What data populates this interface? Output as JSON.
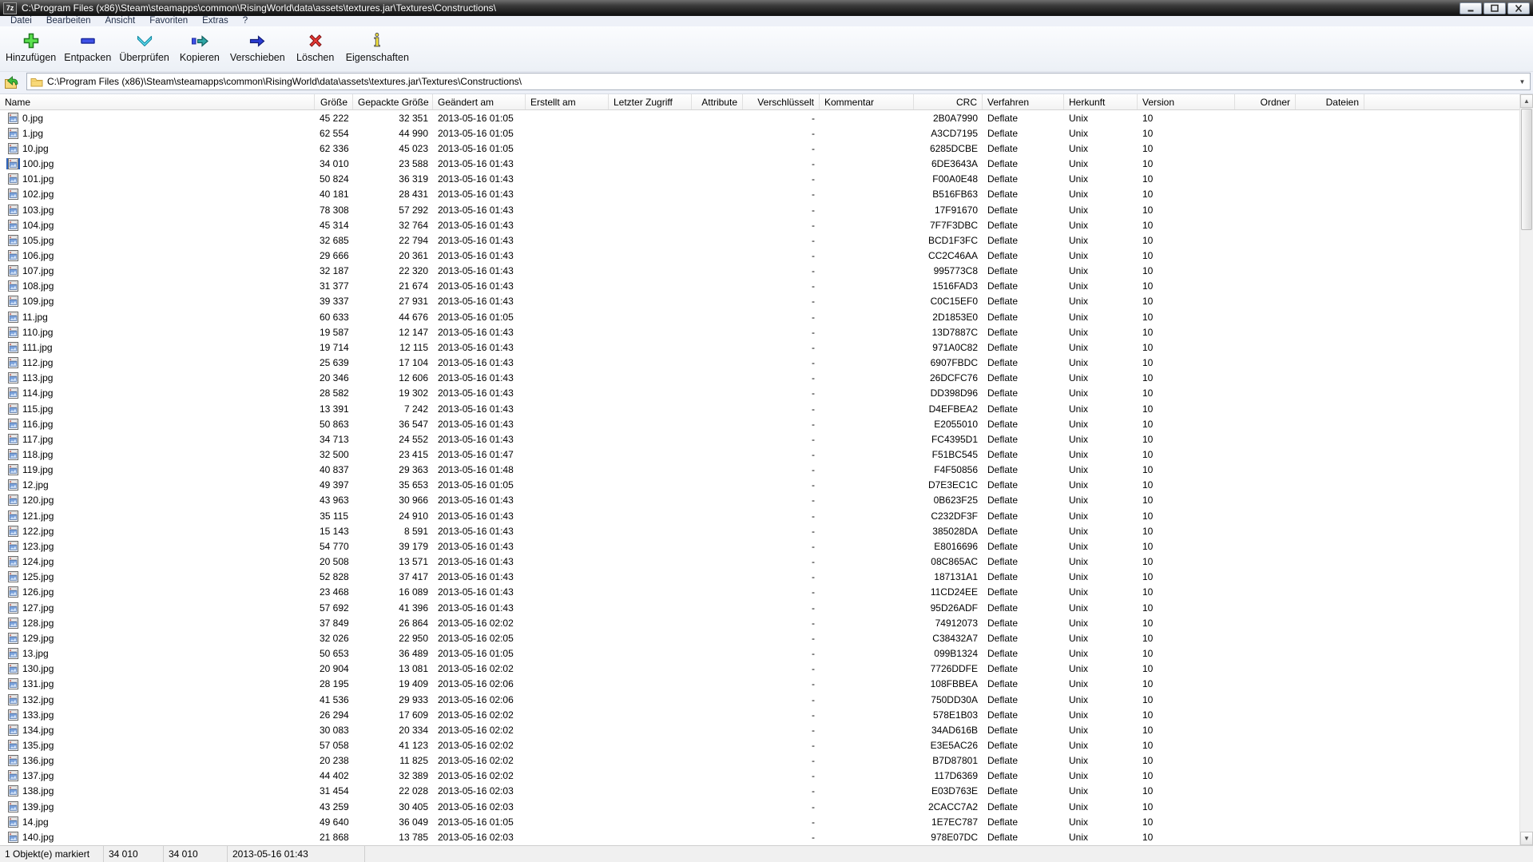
{
  "window": {
    "title": "C:\\Program Files (x86)\\Steam\\steamapps\\common\\RisingWorld\\data\\assets\\textures.jar\\Textures\\Constructions\\",
    "app_badge": "7z"
  },
  "menu": {
    "items": [
      "Datei",
      "Bearbeiten",
      "Ansicht",
      "Favoriten",
      "Extras",
      "?"
    ]
  },
  "toolbar": {
    "buttons": [
      {
        "label": "Hinzufügen",
        "icon": "plus-icon"
      },
      {
        "label": "Entpacken",
        "icon": "minus-icon"
      },
      {
        "label": "Überprüfen",
        "icon": "check-icon"
      },
      {
        "label": "Kopieren",
        "icon": "copy-icon"
      },
      {
        "label": "Verschieben",
        "icon": "move-icon"
      },
      {
        "label": "Löschen",
        "icon": "delete-icon"
      },
      {
        "label": "Eigenschaften",
        "icon": "info-icon"
      }
    ]
  },
  "address": {
    "path": "C:\\Program Files (x86)\\Steam\\steamapps\\common\\RisingWorld\\data\\assets\\textures.jar\\Textures\\Constructions\\"
  },
  "table": {
    "columns": [
      {
        "id": "name",
        "label": "Name"
      },
      {
        "id": "size",
        "label": "Größe"
      },
      {
        "id": "packed",
        "label": "Gepackte Größe"
      },
      {
        "id": "modified",
        "label": "Geändert am"
      },
      {
        "id": "created",
        "label": "Erstellt am"
      },
      {
        "id": "accessed",
        "label": "Letzter Zugriff"
      },
      {
        "id": "attributes",
        "label": "Attribute"
      },
      {
        "id": "encrypted",
        "label": "Verschlüsselt"
      },
      {
        "id": "comment",
        "label": "Kommentar"
      },
      {
        "id": "crc",
        "label": "CRC"
      },
      {
        "id": "method",
        "label": "Verfahren"
      },
      {
        "id": "host",
        "label": "Herkunft"
      },
      {
        "id": "version",
        "label": "Version"
      },
      {
        "id": "folders",
        "label": "Ordner"
      },
      {
        "id": "files",
        "label": "Dateien"
      }
    ],
    "row_fields": [
      "name",
      "size",
      "packed",
      "modified",
      "crc"
    ],
    "row_defaults": {
      "created": "",
      "accessed": "",
      "attributes": "",
      "encrypted": "-",
      "comment": "",
      "method": "Deflate",
      "host": "Unix",
      "version": "10",
      "folders": "",
      "files": ""
    },
    "selected_index": 3,
    "rows": [
      [
        "0.jpg",
        "45 222",
        "32 351",
        "2013-05-16 01:05",
        "2B0A7990"
      ],
      [
        "1.jpg",
        "62 554",
        "44 990",
        "2013-05-16 01:05",
        "A3CD7195"
      ],
      [
        "10.jpg",
        "62 336",
        "45 023",
        "2013-05-16 01:05",
        "6285DCBE"
      ],
      [
        "100.jpg",
        "34 010",
        "23 588",
        "2013-05-16 01:43",
        "6DE3643A"
      ],
      [
        "101.jpg",
        "50 824",
        "36 319",
        "2013-05-16 01:43",
        "F00A0E48"
      ],
      [
        "102.jpg",
        "40 181",
        "28 431",
        "2013-05-16 01:43",
        "B516FB63"
      ],
      [
        "103.jpg",
        "78 308",
        "57 292",
        "2013-05-16 01:43",
        "17F91670"
      ],
      [
        "104.jpg",
        "45 314",
        "32 764",
        "2013-05-16 01:43",
        "7F7F3DBC"
      ],
      [
        "105.jpg",
        "32 685",
        "22 794",
        "2013-05-16 01:43",
        "BCD1F3FC"
      ],
      [
        "106.jpg",
        "29 666",
        "20 361",
        "2013-05-16 01:43",
        "CC2C46AA"
      ],
      [
        "107.jpg",
        "32 187",
        "22 320",
        "2013-05-16 01:43",
        "995773C8"
      ],
      [
        "108.jpg",
        "31 377",
        "21 674",
        "2013-05-16 01:43",
        "1516FAD3"
      ],
      [
        "109.jpg",
        "39 337",
        "27 931",
        "2013-05-16 01:43",
        "C0C15EF0"
      ],
      [
        "11.jpg",
        "60 633",
        "44 676",
        "2013-05-16 01:05",
        "2D1853E0"
      ],
      [
        "110.jpg",
        "19 587",
        "12 147",
        "2013-05-16 01:43",
        "13D7887C"
      ],
      [
        "111.jpg",
        "19 714",
        "12 115",
        "2013-05-16 01:43",
        "971A0C82"
      ],
      [
        "112.jpg",
        "25 639",
        "17 104",
        "2013-05-16 01:43",
        "6907FBDC"
      ],
      [
        "113.jpg",
        "20 346",
        "12 606",
        "2013-05-16 01:43",
        "26DCFC76"
      ],
      [
        "114.jpg",
        "28 582",
        "19 302",
        "2013-05-16 01:43",
        "DD398D96"
      ],
      [
        "115.jpg",
        "13 391",
        "7 242",
        "2013-05-16 01:43",
        "D4EFBEA2"
      ],
      [
        "116.jpg",
        "50 863",
        "36 547",
        "2013-05-16 01:43",
        "E2055010"
      ],
      [
        "117.jpg",
        "34 713",
        "24 552",
        "2013-05-16 01:43",
        "FC4395D1"
      ],
      [
        "118.jpg",
        "32 500",
        "23 415",
        "2013-05-16 01:47",
        "F51BC545"
      ],
      [
        "119.jpg",
        "40 837",
        "29 363",
        "2013-05-16 01:48",
        "F4F50856"
      ],
      [
        "12.jpg",
        "49 397",
        "35 653",
        "2013-05-16 01:05",
        "D7E3EC1C"
      ],
      [
        "120.jpg",
        "43 963",
        "30 966",
        "2013-05-16 01:43",
        "0B623F25"
      ],
      [
        "121.jpg",
        "35 115",
        "24 910",
        "2013-05-16 01:43",
        "C232DF3F"
      ],
      [
        "122.jpg",
        "15 143",
        "8 591",
        "2013-05-16 01:43",
        "385028DA"
      ],
      [
        "123.jpg",
        "54 770",
        "39 179",
        "2013-05-16 01:43",
        "E8016696"
      ],
      [
        "124.jpg",
        "20 508",
        "13 571",
        "2013-05-16 01:43",
        "08C865AC"
      ],
      [
        "125.jpg",
        "52 828",
        "37 417",
        "2013-05-16 01:43",
        "187131A1"
      ],
      [
        "126.jpg",
        "23 468",
        "16 089",
        "2013-05-16 01:43",
        "11CD24EE"
      ],
      [
        "127.jpg",
        "57 692",
        "41 396",
        "2013-05-16 01:43",
        "95D26ADF"
      ],
      [
        "128.jpg",
        "37 849",
        "26 864",
        "2013-05-16 02:02",
        "74912073"
      ],
      [
        "129.jpg",
        "32 026",
        "22 950",
        "2013-05-16 02:05",
        "C38432A7"
      ],
      [
        "13.jpg",
        "50 653",
        "36 489",
        "2013-05-16 01:05",
        "099B1324"
      ],
      [
        "130.jpg",
        "20 904",
        "13 081",
        "2013-05-16 02:02",
        "7726DDFE"
      ],
      [
        "131.jpg",
        "28 195",
        "19 409",
        "2013-05-16 02:06",
        "108FBBEA"
      ],
      [
        "132.jpg",
        "41 536",
        "29 933",
        "2013-05-16 02:06",
        "750DD30A"
      ],
      [
        "133.jpg",
        "26 294",
        "17 609",
        "2013-05-16 02:02",
        "578E1B03"
      ],
      [
        "134.jpg",
        "30 083",
        "20 334",
        "2013-05-16 02:02",
        "34AD616B"
      ],
      [
        "135.jpg",
        "57 058",
        "41 123",
        "2013-05-16 02:02",
        "E3E5AC26"
      ],
      [
        "136.jpg",
        "20 238",
        "11 825",
        "2013-05-16 02:02",
        "B7D87801"
      ],
      [
        "137.jpg",
        "44 402",
        "32 389",
        "2013-05-16 02:02",
        "117D6369"
      ],
      [
        "138.jpg",
        "31 454",
        "22 028",
        "2013-05-16 02:03",
        "E03D763E"
      ],
      [
        "139.jpg",
        "43 259",
        "30 405",
        "2013-05-16 02:03",
        "2CACC7A2"
      ],
      [
        "14.jpg",
        "49 640",
        "36 049",
        "2013-05-16 01:05",
        "1E7EC787"
      ],
      [
        "140.jpg",
        "21 868",
        "13 785",
        "2013-05-16 02:03",
        "978E07DC"
      ]
    ]
  },
  "statusbar": {
    "items": [
      "1 Objekt(e) markiert",
      "34 010",
      "34 010",
      "2013-05-16 01:43"
    ]
  },
  "colors": {
    "selection": "#316ac5",
    "titlebar": "#1c1c1c",
    "toolbar_bg": "#eef1f8"
  }
}
